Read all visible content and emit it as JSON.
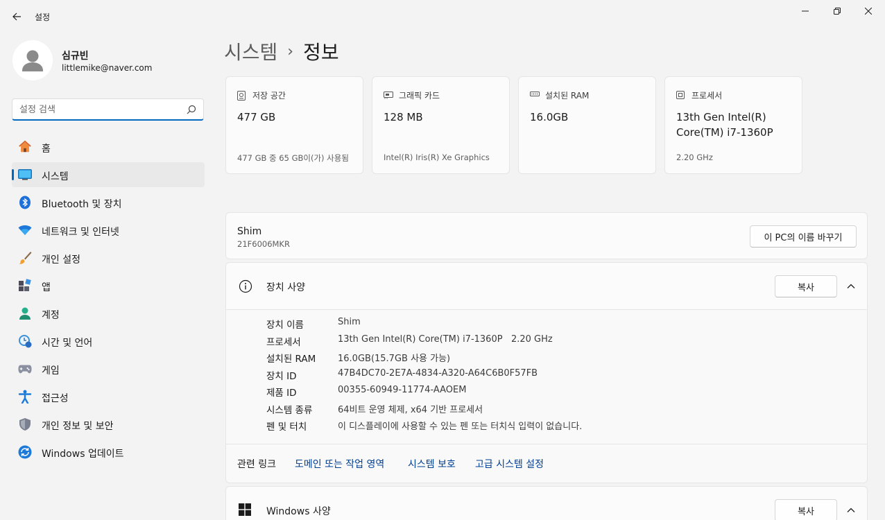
{
  "window": {
    "title": "설정",
    "back_icon": "back-arrow-icon",
    "minimize_icon": "minimize-icon",
    "maximize_icon": "maximize-icon",
    "close_icon": "close-icon"
  },
  "profile": {
    "name": "심규빈",
    "email": "littlemike@naver.com"
  },
  "search": {
    "placeholder": "설정 검색"
  },
  "sidebar": {
    "items": [
      {
        "label": "홈",
        "icon": "home-icon",
        "active": false
      },
      {
        "label": "시스템",
        "icon": "system-icon",
        "active": true
      },
      {
        "label": "Bluetooth 및 장치",
        "icon": "bluetooth-icon",
        "active": false
      },
      {
        "label": "네트워크 및 인터넷",
        "icon": "wifi-icon",
        "active": false
      },
      {
        "label": "개인 설정",
        "icon": "brush-icon",
        "active": false
      },
      {
        "label": "앱",
        "icon": "apps-icon",
        "active": false
      },
      {
        "label": "계정",
        "icon": "account-icon",
        "active": false
      },
      {
        "label": "시간 및 언어",
        "icon": "time-language-icon",
        "active": false
      },
      {
        "label": "게임",
        "icon": "gaming-icon",
        "active": false
      },
      {
        "label": "접근성",
        "icon": "accessibility-icon",
        "active": false
      },
      {
        "label": "개인 정보 및 보안",
        "icon": "shield-icon",
        "active": false
      },
      {
        "label": "Windows 업데이트",
        "icon": "update-icon",
        "active": false
      }
    ]
  },
  "breadcrumb": {
    "parent": "시스템",
    "separator": "›",
    "current": "정보"
  },
  "cards": [
    {
      "title": "저장 공간",
      "icon": "storage-icon",
      "value": "477 GB",
      "sub": "477 GB 중 65 GB이(가) 사용됨"
    },
    {
      "title": "그래픽 카드",
      "icon": "graphics-card-icon",
      "value": "128 MB",
      "sub": "Intel(R) Iris(R) Xe Graphics"
    },
    {
      "title": "설치된 RAM",
      "icon": "ram-icon",
      "value": "16.0GB",
      "sub": ""
    },
    {
      "title": "프로세서",
      "icon": "processor-icon",
      "value": "13th Gen Intel(R) Core(TM) i7-1360P",
      "sub": "2.20 GHz"
    }
  ],
  "pc": {
    "name": "Shim",
    "model": "21F6006MKR",
    "rename_label": "이 PC의 이름 바꾸기"
  },
  "device_specs": {
    "title": "장치 사양",
    "copy_label": "복사",
    "rows": [
      {
        "label": "장치 이름",
        "value": "Shim"
      },
      {
        "label": "프로세서",
        "value": "13th Gen Intel(R) Core(TM) i7-1360P   2.20 GHz"
      },
      {
        "label": "설치된 RAM",
        "value": "16.0GB(15.7GB 사용 가능)"
      },
      {
        "label": "장치 ID",
        "value": "47B4DC70-2E7A-4834-A320-A64C6B0F57FB"
      },
      {
        "label": "제품 ID",
        "value": "00355-60949-11774-AAOEM"
      },
      {
        "label": "시스템 종류",
        "value": "64비트 운영 체제, x64 기반 프로세서"
      },
      {
        "label": "펜 및 터치",
        "value": "이 디스플레이에 사용할 수 있는 펜 또는 터치식 입력이 없습니다."
      }
    ]
  },
  "related_links": {
    "label": "관련 링크",
    "links": [
      "도메인 또는 작업 영역",
      "시스템 보호",
      "고급 시스템 설정"
    ]
  },
  "windows_specs": {
    "title": "Windows 사양",
    "copy_label": "복사"
  },
  "colors": {
    "accent": "#0067c0",
    "link": "#003e92",
    "background": "#f3f3f3",
    "card": "#fbfbfb"
  }
}
